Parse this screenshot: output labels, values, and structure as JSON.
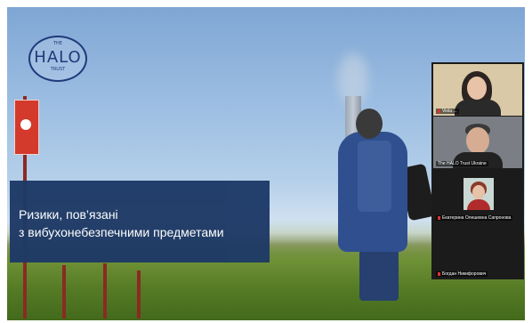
{
  "slide": {
    "logo": {
      "the": "THE",
      "halo": "HALO",
      "trust": "TRUST"
    },
    "title_line1": "Ризики, пов’язані",
    "title_line2": "з вибухонебезпечними предметами"
  },
  "participants": [
    {
      "name": "Viola ...",
      "mic_muted": true
    },
    {
      "name": "The HALO Trust Ukraine",
      "mic_muted": false
    },
    {
      "name": "Екатерина Олешевна Сапронова",
      "mic_muted": true
    },
    {
      "name": "Богдан Никифорович",
      "mic_muted": true
    }
  ],
  "colors": {
    "title_box": "#1e3a66",
    "logo": "#1f3a7a",
    "panel_bg": "#1b1b1b",
    "muted_mic": "#e0322a"
  }
}
